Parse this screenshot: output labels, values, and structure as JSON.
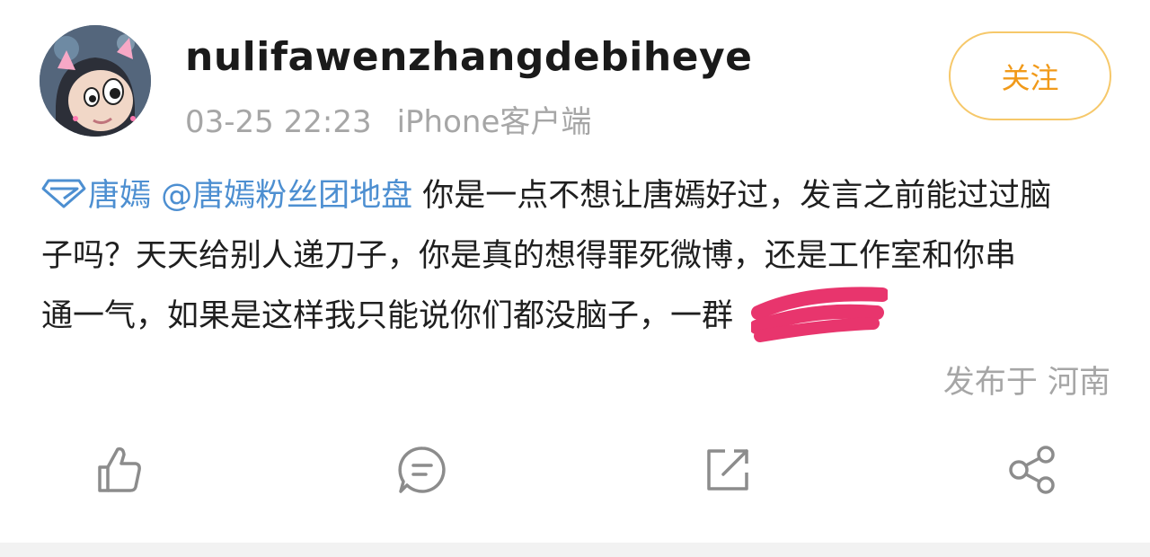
{
  "post": {
    "username": "nulifawenzhangdebiheye",
    "time": "03-25 22:23",
    "source": "iPhone客户端",
    "follow_label": "关注",
    "topic_name": "唐嫣",
    "mention": "@唐嫣粉丝团地盘",
    "lines": [
      " 你是一点不想让唐嫣好过，发言之前能过过脑",
      "子吗？天天给别人递刀子，你是真的想得罪死微博，还是工作室和你串",
      "通一气，如果是这样我只能说你们都没脑子，一群"
    ],
    "location": "发布于 河南"
  },
  "actions": [
    {
      "icon": "like-icon"
    },
    {
      "icon": "comment-icon"
    },
    {
      "icon": "repost-icon"
    },
    {
      "icon": "share-icon"
    }
  ],
  "colors": {
    "link": "#4d8fd1",
    "follow_text": "#f19a1a",
    "follow_border": "#f6c86a",
    "scribble": "#e8356d",
    "muted": "#a6a6a6"
  }
}
